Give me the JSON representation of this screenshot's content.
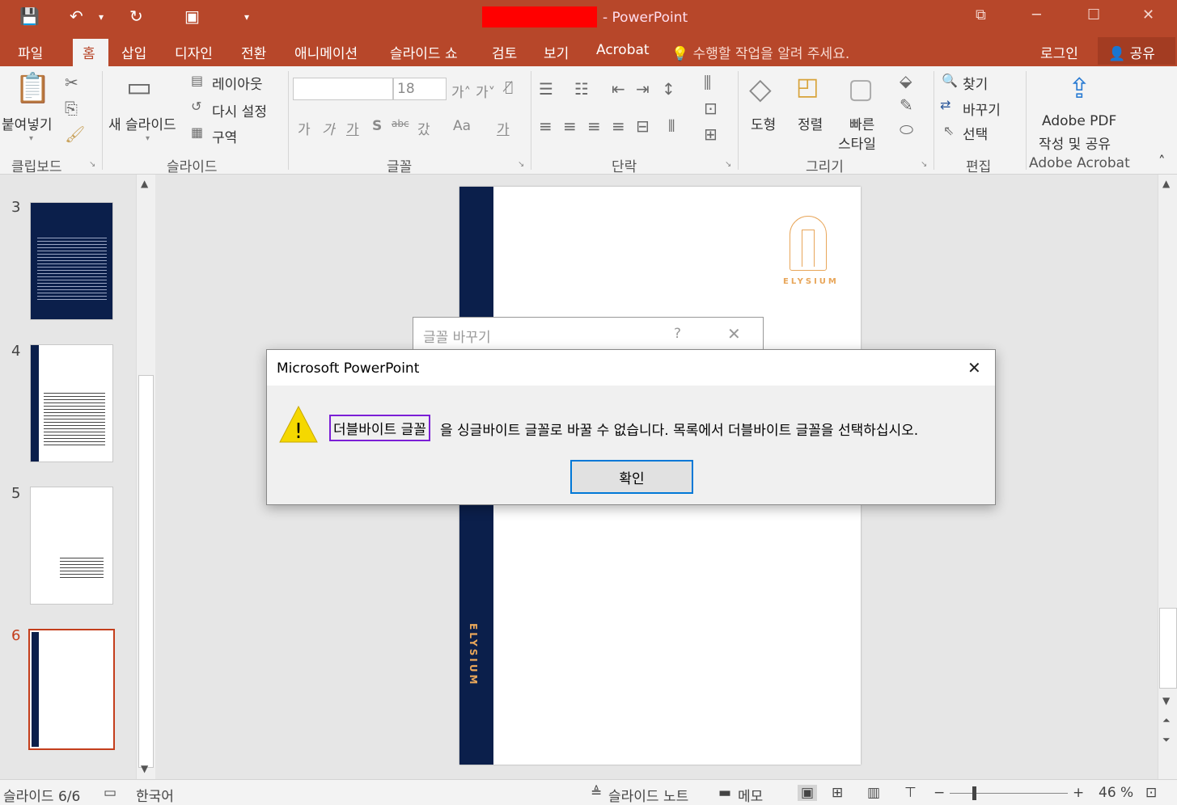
{
  "window": {
    "app_suffix": "- PowerPoint"
  },
  "tabs": [
    "파일",
    "홈",
    "삽입",
    "디자인",
    "전환",
    "애니메이션",
    "슬라이드 쇼",
    "검토",
    "보기",
    "Acrobat"
  ],
  "tell_me": "수행할 작업을 알려 주세요.",
  "login": "로그인",
  "share": "공유",
  "ribbon": {
    "paste": "붙여넣기",
    "new_slide": "새 슬라이드",
    "layout": "레이아웃",
    "reset": "다시 설정",
    "section": "구역",
    "font_size": "18",
    "shapes": "도형",
    "arrange": "정렬",
    "quick_styles": [
      "빠른",
      "스타일"
    ],
    "find": "찾기",
    "replace": "바꾸기",
    "select": "선택",
    "adobe_pdf": [
      "Adobe PDF",
      "작성 및 공유"
    ],
    "groups": {
      "clipboard": "클립보드",
      "slides": "슬라이드",
      "font": "글꼴",
      "paragraph": "단락",
      "drawing": "그리기",
      "editing": "편집",
      "acrobat": "Adobe Acrobat"
    }
  },
  "thumbnails": [
    {
      "num": "3"
    },
    {
      "num": "4"
    },
    {
      "num": "5"
    },
    {
      "num": "6"
    }
  ],
  "slide": {
    "logo_text": "ELYSIUM",
    "side_text": "ELYSIUM"
  },
  "replace_dialog": {
    "title": "글꼴 바꾸기",
    "help": "?"
  },
  "message_dialog": {
    "title": "Microsoft PowerPoint",
    "highlighted": "더블바이트 글꼴",
    "message_rest": "을 싱글바이트 글꼴로 바꿀 수 없습니다. 목록에서 더블바이트 글꼴을 선택하십시오.",
    "ok": "확인",
    "highlight_color": "#7b1fd6"
  },
  "status": {
    "slide_info": "슬라이드 6/6",
    "language": "한국어",
    "notes": "슬라이드 노트",
    "comments": "메모",
    "zoom": "46 %"
  },
  "colors": {
    "accent": "#b7472a",
    "navy": "#0b1f4b",
    "gold": "#e8a65a"
  }
}
